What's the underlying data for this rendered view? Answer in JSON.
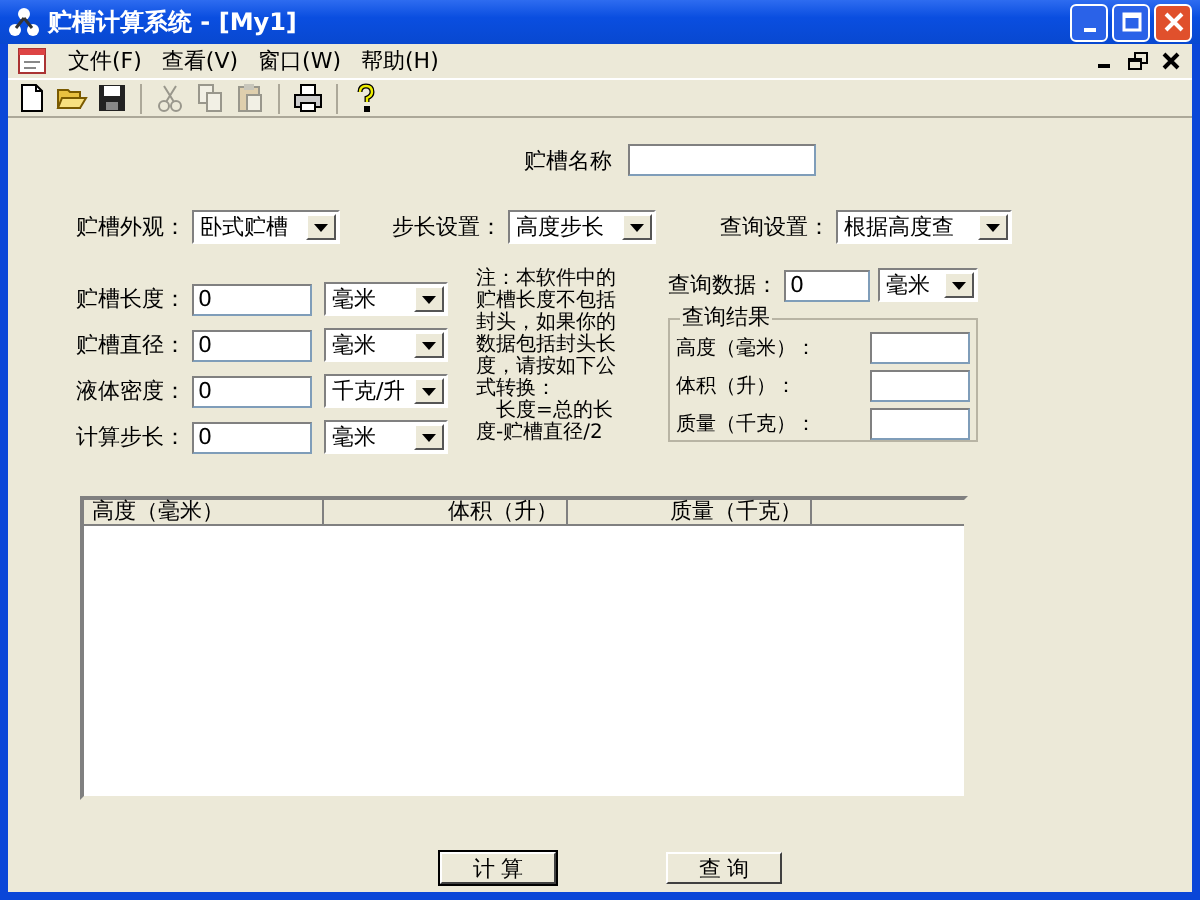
{
  "window": {
    "title": "贮槽计算系统 - [My1]"
  },
  "menu": [
    {
      "label": "文件(F)"
    },
    {
      "label": "查看(V)"
    },
    {
      "label": "窗口(W)"
    },
    {
      "label": "帮助(H)"
    }
  ],
  "toolbar": [
    {
      "kind": "new",
      "disabled": false
    },
    {
      "kind": "open",
      "disabled": false
    },
    {
      "kind": "save",
      "disabled": false
    },
    {
      "kind": "cut",
      "disabled": true
    },
    {
      "kind": "copy",
      "disabled": true
    },
    {
      "kind": "paste",
      "disabled": true
    },
    {
      "kind": "print",
      "disabled": false
    },
    {
      "kind": "help",
      "disabled": false
    }
  ],
  "name_field": {
    "label": "贮槽名称"
  },
  "settings": [
    {
      "label": "贮槽外观：",
      "value": "卧式贮槽"
    },
    {
      "label": "步长设置：",
      "value": "高度步长"
    },
    {
      "label": "查询设置：",
      "value": "根据高度查"
    }
  ],
  "inputs": [
    {
      "label": "贮槽长度：",
      "value": "0",
      "unit": "毫米"
    },
    {
      "label": "贮槽直径：",
      "value": "0",
      "unit": "毫米"
    },
    {
      "label": "液体密度：",
      "value": "0",
      "unit": "千克/升"
    },
    {
      "label": "计算步长：",
      "value": "0",
      "unit": "毫米"
    }
  ],
  "note": [
    "注：本软件中的贮槽长度不包括封头，如果你的数据包括封头长度，请按如下公式转换：",
    "长度=总的长度-贮槽直径/2"
  ],
  "query": {
    "label": "查询数据：",
    "value": "0",
    "unit": "毫米"
  },
  "results": {
    "title": "查询结果",
    "rows": [
      {
        "label": "高度（毫米）："
      },
      {
        "label": "体积（升）："
      },
      {
        "label": "质量（千克）："
      }
    ]
  },
  "table": {
    "columns": [
      "高度（毫米）",
      "体积（升）",
      "质量（千克）"
    ]
  },
  "buttons": [
    {
      "label": "计 算",
      "focused": true
    },
    {
      "label": "查 询",
      "focused": false
    }
  ]
}
